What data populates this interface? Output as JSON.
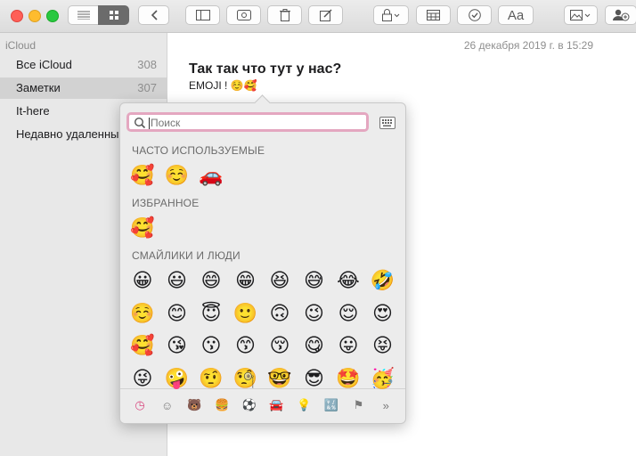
{
  "toolbar": {
    "buttons": [
      {
        "name": "list-view-button",
        "icon": "list-icon"
      },
      {
        "name": "gallery-view-button",
        "icon": "grid-icon"
      },
      {
        "name": "back-button",
        "icon": "chevron-left-icon"
      },
      {
        "name": "toggle-sidebar-button",
        "icon": "sidebar-icon"
      },
      {
        "name": "attachments-button",
        "icon": "attachment-icon"
      },
      {
        "name": "delete-button",
        "icon": "trash-icon"
      },
      {
        "name": "new-note-button",
        "icon": "compose-icon"
      },
      {
        "name": "lock-button",
        "icon": "lock-icon"
      },
      {
        "name": "table-button",
        "icon": "table-icon"
      },
      {
        "name": "checklist-button",
        "icon": "checkmark-circle-icon"
      },
      {
        "name": "format-button",
        "icon": "format-text-icon"
      },
      {
        "name": "media-button",
        "icon": "photo-icon"
      },
      {
        "name": "share-button",
        "icon": "add-person-icon"
      }
    ],
    "format_label": "Aa"
  },
  "sidebar": {
    "account": "iCloud",
    "items": [
      {
        "label": "Все iCloud",
        "count": "308",
        "selected": false
      },
      {
        "label": "Заметки",
        "count": "307",
        "selected": true
      },
      {
        "label": "It-here",
        "count": "",
        "selected": false
      },
      {
        "label": "Недавно удаленные",
        "count": "",
        "selected": false
      }
    ]
  },
  "note": {
    "date": "26 декабря 2019 г. в 15:29",
    "title": "Так так что тут у нас?",
    "body": "EMOJI ! ☺️🥰"
  },
  "emoji_picker": {
    "search_placeholder": "Поиск",
    "sections": {
      "frequent": "ЧАСТО ИСПОЛЬЗУЕМЫЕ",
      "favorites": "ИЗБРАННОЕ",
      "smileys": "СМАЙЛИКИ И ЛЮДИ"
    },
    "frequent": [
      "🥰",
      "☺️",
      "🚗"
    ],
    "favorites": [
      "🥰"
    ],
    "smileys": [
      [
        "😀",
        "😃",
        "😄",
        "😁",
        "😆",
        "😅",
        "😂",
        "🤣"
      ],
      [
        "☺️",
        "😊",
        "😇",
        "🙂",
        "🙃",
        "😉",
        "😌",
        "😍"
      ],
      [
        "🥰",
        "😘",
        "😗",
        "😙",
        "😚",
        "😋",
        "😛",
        "😝"
      ],
      [
        "😜",
        "🤪",
        "🤨",
        "🧐",
        "🤓",
        "😎",
        "🤩",
        "🥳"
      ]
    ],
    "categories": [
      {
        "name": "recent-clock-icon",
        "glyph": "◷",
        "selected": true
      },
      {
        "name": "smiley-icon",
        "glyph": "☺",
        "selected": false
      },
      {
        "name": "animal-icon",
        "glyph": "🐻",
        "selected": false
      },
      {
        "name": "food-icon",
        "glyph": "🍔",
        "selected": false
      },
      {
        "name": "ball-icon",
        "glyph": "⚽",
        "selected": false
      },
      {
        "name": "car-icon",
        "glyph": "🚘",
        "selected": false
      },
      {
        "name": "lightbulb-icon",
        "glyph": "💡",
        "selected": false
      },
      {
        "name": "symbols-icon",
        "glyph": "🔣",
        "selected": false
      },
      {
        "name": "flag-icon",
        "glyph": "⚑",
        "selected": false
      },
      {
        "name": "more-icon",
        "glyph": "»",
        "selected": false
      }
    ]
  }
}
